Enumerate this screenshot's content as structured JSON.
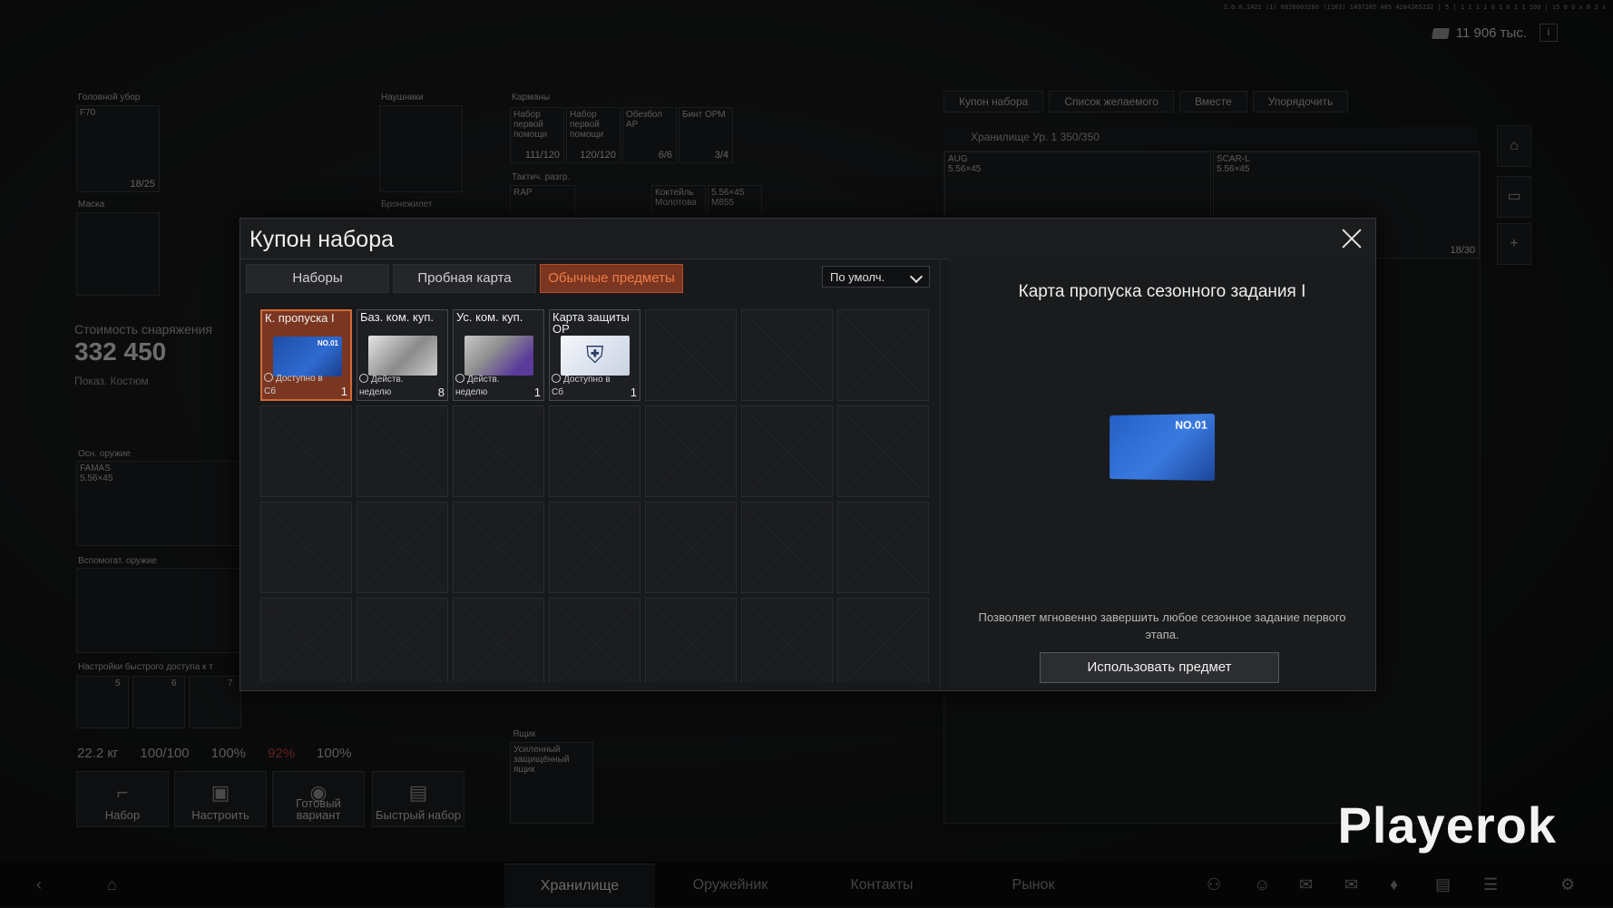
{
  "header": {
    "version_line": "1.0.0.1421 (1) 0820603260 (1103) 1497205 485 4284265232 | 5 | 1 1 1 1 0 1 0 1 1 100 | 15 0 0 x 0 3 x",
    "currency_value": "11 906 тыс.",
    "info_label": "i"
  },
  "gear": {
    "headwear_label": "Головной убор",
    "headwear_item": "F70",
    "headwear_durability": "18/25",
    "headphones_label": "Наушники",
    "mask_label": "Маска",
    "armor_label": "Бронежилет",
    "pockets_label": "Карманы",
    "pocket_items": [
      {
        "name": "Набор первой помощи",
        "qty": "111/120"
      },
      {
        "name": "Набор первой помощи",
        "qty": "120/120"
      },
      {
        "name": "Обезбол АР",
        "qty": "6/6"
      },
      {
        "name": "Бинт ОРМ",
        "qty": "3/4"
      }
    ],
    "vest_label": "Тактич. разгр.",
    "vest_item": "RAP",
    "vest_small_items": [
      "Коктейль Молотова",
      "5.56×45 M855"
    ],
    "primary_label": "Осн. оружие",
    "primary_name": "FAMAS",
    "primary_caliber": "5.56×45",
    "secondary_label": "Вспомогат. оружие",
    "quick_access_label": "Настройки быстрого доступа к т",
    "quick_slots": [
      "5",
      "6",
      "7"
    ],
    "cost_label": "Стоимость снаряжения",
    "cost_value": "332 450",
    "preview_label": "Показ. Костюм",
    "box_label": "Ящик",
    "box_item": "Усиленный защищённый ящик"
  },
  "stats": {
    "weight": "22.2 кг",
    "stat2": "100/100",
    "stat3": "100%",
    "stat4": "92%",
    "stat5": "100%"
  },
  "loadout_buttons": [
    {
      "label": "Набор",
      "glyph": "⌐"
    },
    {
      "label": "Настроить",
      "glyph": "▣"
    },
    {
      "label": "Готовый вариант",
      "glyph": "◉"
    },
    {
      "label": "Быстрый набор",
      "glyph": "▤"
    }
  ],
  "stash": {
    "top_buttons": [
      "Купон набора",
      "Список желаемого",
      "Вместе",
      "Упорядочить"
    ],
    "title": "Хранилище Ур. 1  350/350",
    "weapons": [
      {
        "name": "AUG",
        "caliber": "5.56×45"
      },
      {
        "name": "SCAR-L",
        "caliber": "5.56×45",
        "qty": "18/30"
      }
    ]
  },
  "bottom_nav": {
    "tabs": [
      "Хранилище",
      "Оружейник",
      "Контакты",
      "Рынок"
    ],
    "active_tab": "Хранилище"
  },
  "watermark": "Playerok",
  "modal": {
    "title": "Купон набора",
    "tabs": [
      "Наборы",
      "Пробная карта",
      "Обычные предметы"
    ],
    "active_tab": "Обычные предметы",
    "sort_value": "По умолч.",
    "items": [
      {
        "name": "К. пропуска I",
        "timer": "Доступно в Сб",
        "count": "1",
        "style": "blue",
        "selected": true
      },
      {
        "name": "Баз. ком. куп.",
        "timer": "Действ. неделю",
        "count": "8",
        "style": "bw",
        "selected": false
      },
      {
        "name": "Ус. ком. куп.",
        "timer": "Действ. неделю",
        "count": "1",
        "style": "purple",
        "selected": false
      },
      {
        "name": "Карта защиты ОР",
        "timer": "Доступно в Сб",
        "count": "1",
        "style": "shield",
        "selected": false
      }
    ],
    "total_cells": 28,
    "detail": {
      "title": "Карта пропуска сезонного задания I",
      "description": "Позволяет мгновенно завершить любое сезонное задание первого этапа.",
      "use_button": "Использовать предмет"
    }
  }
}
